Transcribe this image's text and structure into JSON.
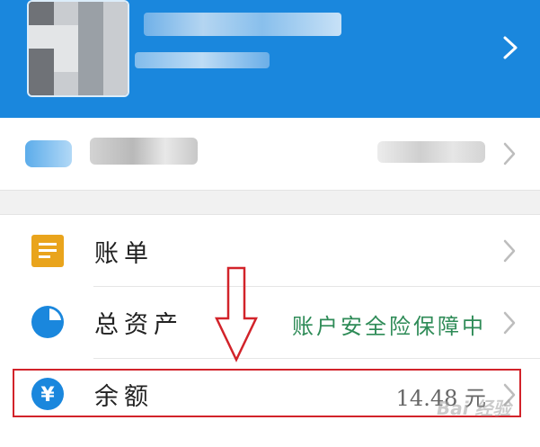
{
  "header": {
    "avatar": "avatar",
    "icons": {
      "chevron": "chevron-right-icon"
    }
  },
  "account_row": {
    "icons": {
      "chevron": "chevron-right-icon"
    }
  },
  "menu": {
    "items": [
      {
        "label": "账单",
        "value": "",
        "icon": "bill-document-icon",
        "icon_color": "#e9a41c"
      },
      {
        "label": "总资产",
        "value": "账户安全险保障中",
        "value_color": "#2e8b57",
        "icon": "pie-chart-icon",
        "icon_color": "#1a87dd"
      },
      {
        "label": "余额",
        "value": "14.48 元",
        "value_color": "#666666",
        "icon": "yuan-circle-icon",
        "icon_color": "#1a87dd"
      }
    ]
  },
  "annotation": {
    "arrow_color": "#d2232a",
    "box_color": "#d2232a"
  },
  "watermark": {
    "text": "Bai 经验"
  }
}
